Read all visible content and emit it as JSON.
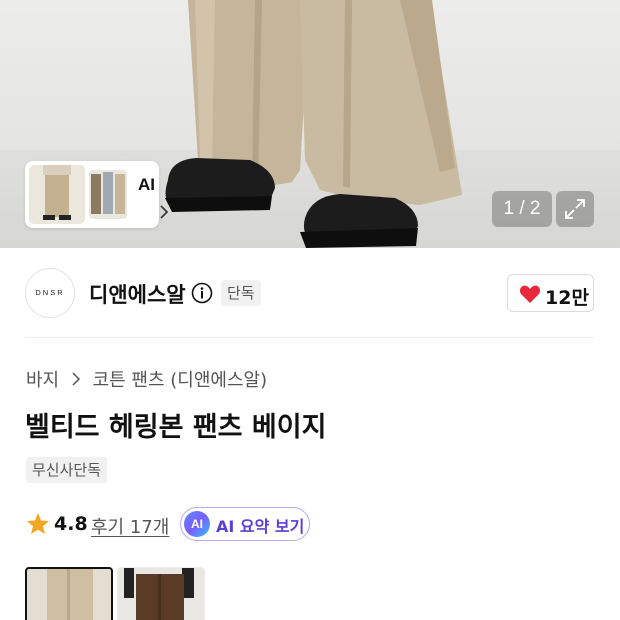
{
  "gallery": {
    "thumb_ai_label": "AI",
    "counter": "1 / 2"
  },
  "brand": {
    "logo_text": "DNSR",
    "name": "디앤에스알",
    "exclusive_badge": "단독",
    "like_count": "12만"
  },
  "breadcrumb": {
    "category": "바지",
    "subcategory": "코튼 팬츠 (디앤에스알)"
  },
  "product": {
    "title": "벨티드 헤링본 팬츠 베이지",
    "tag": "무신사단독",
    "rating": "4.8",
    "reviews_label": "후기 17개",
    "ai_badge": "AI",
    "ai_summary_label": "AI 요약 보기"
  },
  "colors": {
    "accent_red": "#e8293b",
    "star": "#f5a623",
    "ai_purple": "#5a3fd6"
  }
}
